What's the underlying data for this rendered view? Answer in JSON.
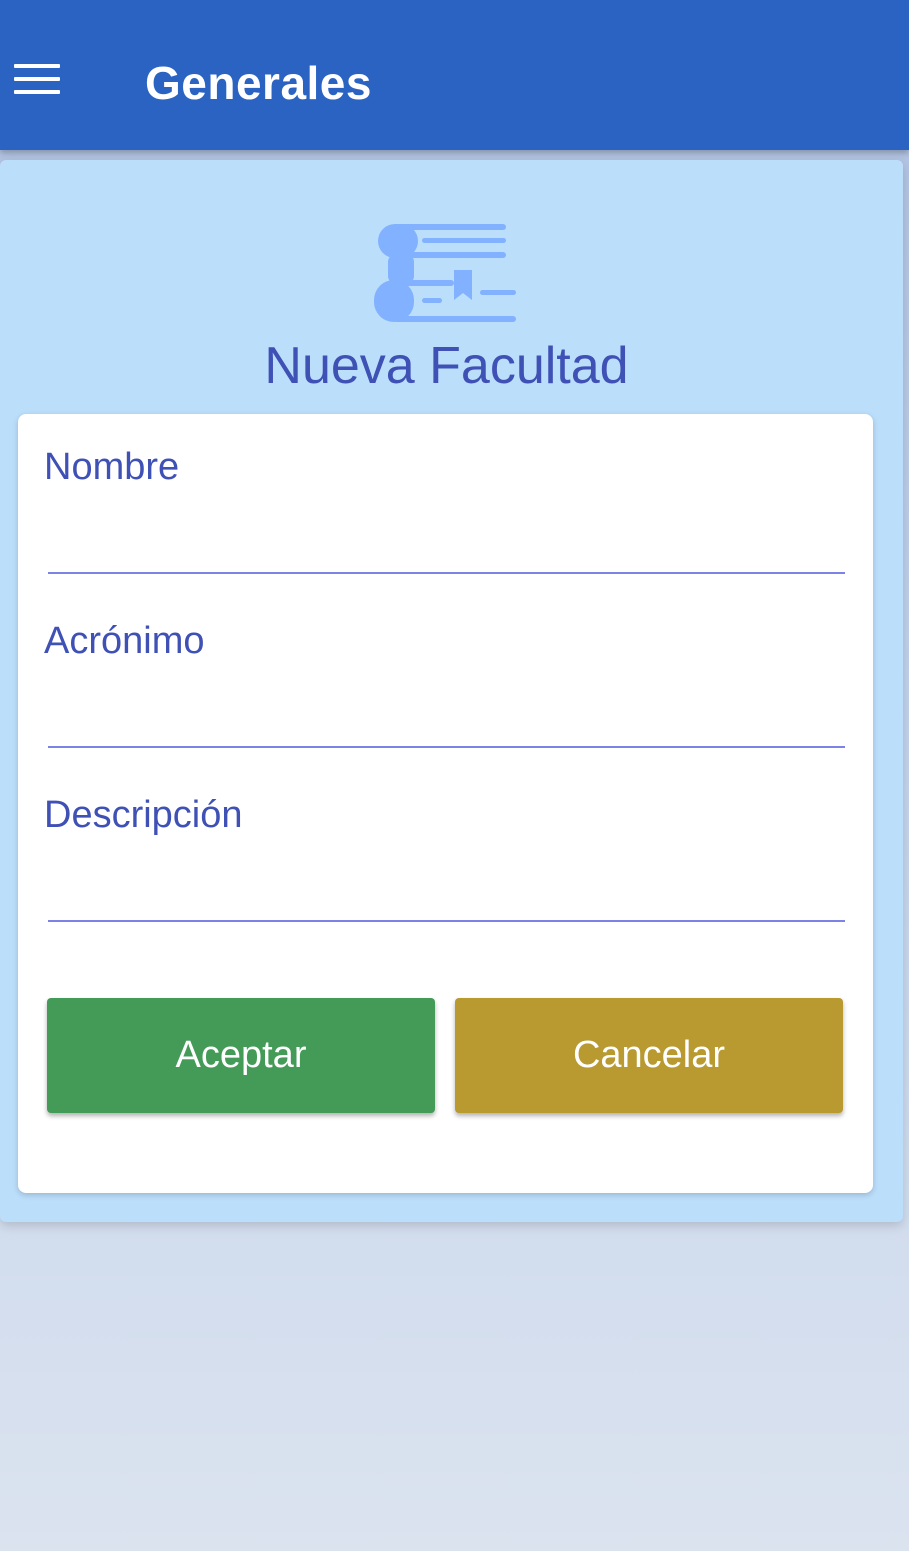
{
  "appbar": {
    "title": "Generales",
    "color": "#2b63c3"
  },
  "icons": {
    "menu": "menu-icon",
    "header": "books-icon"
  },
  "form": {
    "title": "Nueva Facultad",
    "fields": [
      {
        "label": "Nombre",
        "value": "",
        "placeholder": ""
      },
      {
        "label": "Acrónimo",
        "value": "",
        "placeholder": ""
      },
      {
        "label": "Descripción",
        "value": "",
        "placeholder": ""
      }
    ],
    "accept_label": "Aceptar",
    "cancel_label": "Cancelar"
  },
  "colors": {
    "accent": "#3f51b5",
    "panel": "#bbdefb",
    "accept": "#449b57",
    "cancel": "#b89a31",
    "underline": "#7b83e6"
  }
}
